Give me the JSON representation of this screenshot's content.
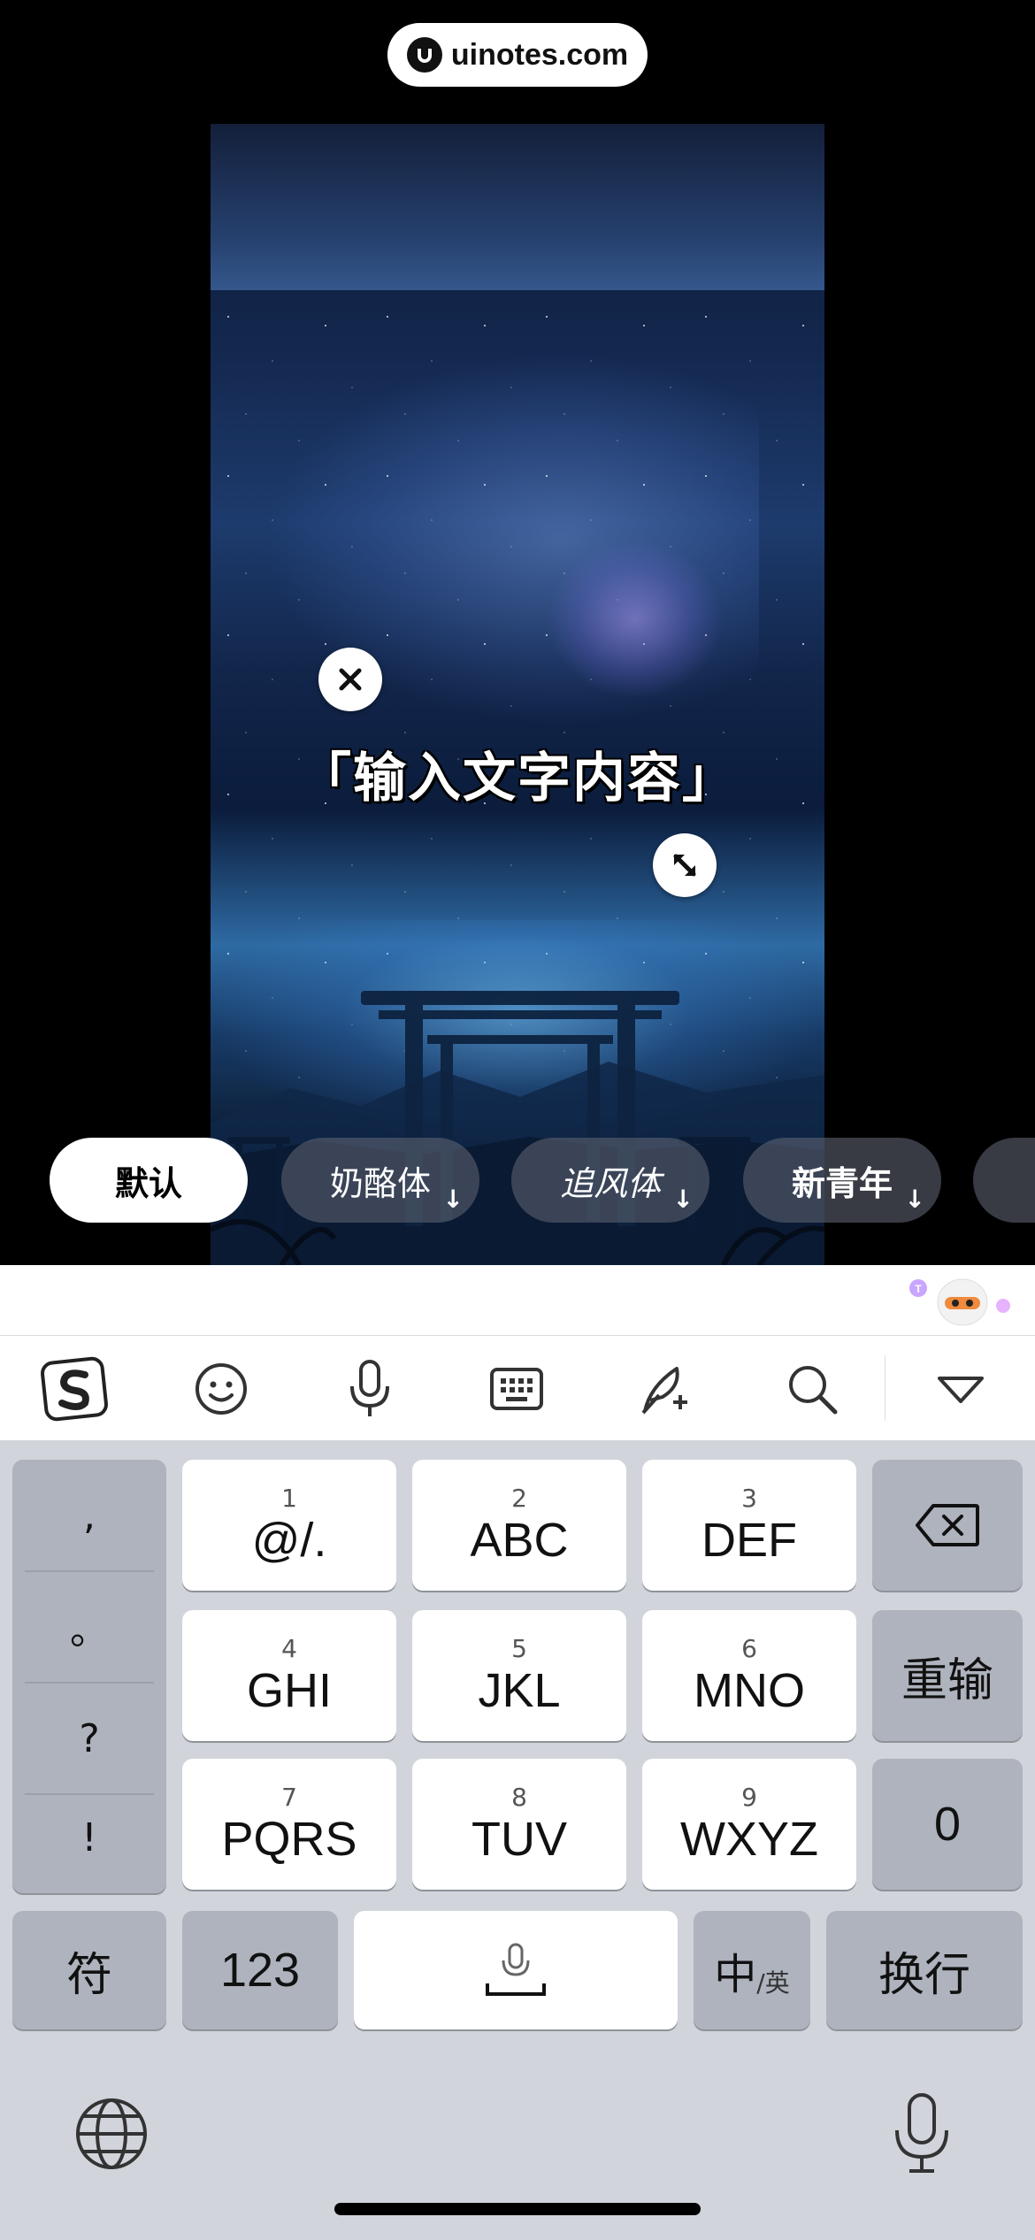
{
  "watermark": {
    "text": "uinotes.com"
  },
  "overlay": {
    "text": "「输入文字内容」"
  },
  "font_chips": [
    {
      "label": "默认",
      "active": true,
      "downloadable": false
    },
    {
      "label": "奶酪体",
      "active": false,
      "downloadable": true
    },
    {
      "label": "追风体",
      "active": false,
      "downloadable": true
    },
    {
      "label": "新青年",
      "active": false,
      "downloadable": true
    }
  ],
  "toolbar": {
    "icons": [
      "sogou-logo-icon",
      "emoji-icon",
      "voice-icon",
      "keyboard-icon",
      "handwriting-icon",
      "search-icon",
      "collapse-keyboard-icon"
    ]
  },
  "keyboard": {
    "punctuation": [
      ",",
      "。",
      "?",
      "!"
    ],
    "keys": [
      {
        "num": "1",
        "label": "@/."
      },
      {
        "num": "2",
        "label": "ABC"
      },
      {
        "num": "3",
        "label": "DEF"
      },
      {
        "num": "4",
        "label": "GHI"
      },
      {
        "num": "5",
        "label": "JKL"
      },
      {
        "num": "6",
        "label": "MNO"
      },
      {
        "num": "7",
        "label": "PQRS"
      },
      {
        "num": "8",
        "label": "TUV"
      },
      {
        "num": "9",
        "label": "WXYZ"
      }
    ],
    "reenter": "重输",
    "zero": "0",
    "symbols": "符",
    "numbers": "123",
    "lang_main": "中",
    "lang_sub": "/英",
    "enter": "换行"
  },
  "colors": {
    "keyboard_bg": "#d1d4db",
    "key_white": "#ffffff",
    "key_gray": "#aeb3bd",
    "chip_active": "#ffffff",
    "chip_inactive": "#5a5f6e"
  }
}
